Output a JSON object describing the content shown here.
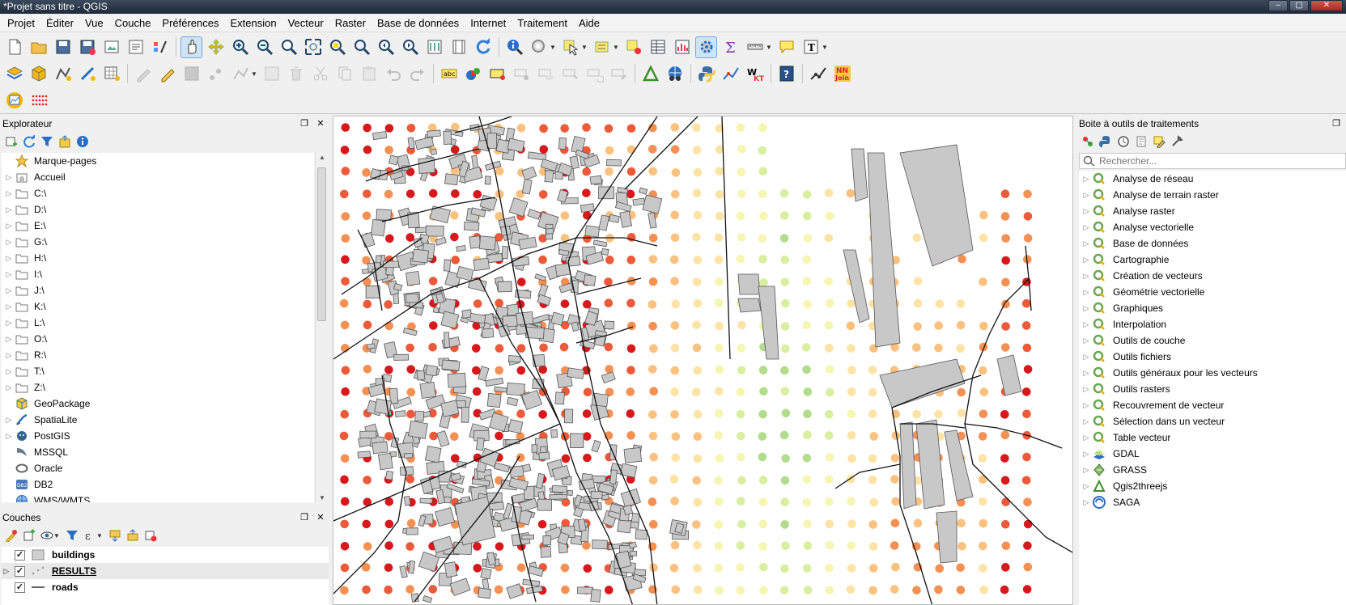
{
  "window": {
    "title": "*Projet sans titre - QGIS"
  },
  "menubar": [
    "Projet",
    "Éditer",
    "Vue",
    "Couche",
    "Préférences",
    "Extension",
    "Vecteur",
    "Raster",
    "Base de données",
    "Internet",
    "Traitement",
    "Aide"
  ],
  "explorer": {
    "title": "Explorateur",
    "items": [
      {
        "label": "Marque-pages",
        "icon": "star-icon",
        "expandable": false
      },
      {
        "label": "Accueil",
        "icon": "home-folder-icon",
        "expandable": true
      },
      {
        "label": "C:\\",
        "icon": "folder-icon",
        "expandable": true
      },
      {
        "label": "D:\\",
        "icon": "folder-icon",
        "expandable": true
      },
      {
        "label": "E:\\",
        "icon": "folder-icon",
        "expandable": true
      },
      {
        "label": "G:\\",
        "icon": "folder-icon",
        "expandable": true
      },
      {
        "label": "H:\\",
        "icon": "folder-icon",
        "expandable": true
      },
      {
        "label": "I:\\",
        "icon": "folder-icon",
        "expandable": true
      },
      {
        "label": "J:\\",
        "icon": "folder-icon",
        "expandable": true
      },
      {
        "label": "K:\\",
        "icon": "folder-icon",
        "expandable": true
      },
      {
        "label": "L:\\",
        "icon": "folder-icon",
        "expandable": true
      },
      {
        "label": "O:\\",
        "icon": "folder-icon",
        "expandable": true
      },
      {
        "label": "R:\\",
        "icon": "folder-icon",
        "expandable": true
      },
      {
        "label": "T:\\",
        "icon": "folder-icon",
        "expandable": true
      },
      {
        "label": "Z:\\",
        "icon": "folder-icon",
        "expandable": true
      },
      {
        "label": "GeoPackage",
        "icon": "geopackage-icon",
        "expandable": false
      },
      {
        "label": "SpatiaLite",
        "icon": "spatialite-icon",
        "expandable": true
      },
      {
        "label": "PostGIS",
        "icon": "postgis-icon",
        "expandable": true
      },
      {
        "label": "MSSQL",
        "icon": "mssql-icon",
        "expandable": false
      },
      {
        "label": "Oracle",
        "icon": "oracle-icon",
        "expandable": false
      },
      {
        "label": "DB2",
        "icon": "db2-icon",
        "expandable": false
      },
      {
        "label": "WMS/WMTS",
        "icon": "wms-icon",
        "expandable": false
      }
    ]
  },
  "layers": {
    "title": "Couches",
    "items": [
      {
        "name": "buildings",
        "checked": true,
        "symbol": "polygon-gray",
        "selected": false,
        "underline": false
      },
      {
        "name": "RESULTS",
        "checked": true,
        "symbol": "points",
        "selected": true,
        "underline": true
      },
      {
        "name": "roads",
        "checked": true,
        "symbol": "line-black",
        "selected": false,
        "underline": false
      }
    ]
  },
  "toolbox": {
    "title": "Boite à outils de traitements",
    "search_placeholder": "Rechercher...",
    "items": [
      {
        "label": "Analyse de réseau",
        "icon": "qgis-icon"
      },
      {
        "label": "Analyse de terrain raster",
        "icon": "qgis-icon"
      },
      {
        "label": "Analyse raster",
        "icon": "qgis-icon"
      },
      {
        "label": "Analyse vectorielle",
        "icon": "qgis-icon"
      },
      {
        "label": "Base de données",
        "icon": "qgis-icon"
      },
      {
        "label": "Cartographie",
        "icon": "qgis-icon"
      },
      {
        "label": "Création de vecteurs",
        "icon": "qgis-icon"
      },
      {
        "label": "Géométrie vectorielle",
        "icon": "qgis-icon"
      },
      {
        "label": "Graphiques",
        "icon": "qgis-icon"
      },
      {
        "label": "Interpolation",
        "icon": "qgis-icon"
      },
      {
        "label": "Outils de couche",
        "icon": "qgis-icon"
      },
      {
        "label": "Outils fichiers",
        "icon": "qgis-icon"
      },
      {
        "label": "Outils généraux pour les vecteurs",
        "icon": "qgis-icon"
      },
      {
        "label": "Outils rasters",
        "icon": "qgis-icon"
      },
      {
        "label": "Recouvrement de vecteur",
        "icon": "qgis-icon"
      },
      {
        "label": "Sélection dans un vecteur",
        "icon": "qgis-icon"
      },
      {
        "label": "Table vecteur",
        "icon": "qgis-icon"
      },
      {
        "label": "GDAL",
        "icon": "gdal-icon"
      },
      {
        "label": "GRASS",
        "icon": "grass-icon"
      },
      {
        "label": "Qgis2threejs",
        "icon": "qgis2threejs-icon"
      },
      {
        "label": "SAGA",
        "icon": "saga-icon"
      }
    ]
  },
  "toolbar_labels": {
    "nn_join_line1": "NN",
    "nn_join_line2": "Join",
    "abc": "abc",
    "wkt_w": "W",
    "wkt_kt": "KT",
    "help": "?"
  },
  "map_colors": {
    "background": "#ffffff",
    "buildings_fill": "#c8c8c8",
    "buildings_stroke": "#555555",
    "roads": "#111111",
    "result_classes": [
      "#d7191c",
      "#ec5a3a",
      "#f59053",
      "#fbc17f",
      "#fde4a6",
      "#f6f5b2",
      "#d9efa0",
      "#b2dd8c"
    ]
  }
}
